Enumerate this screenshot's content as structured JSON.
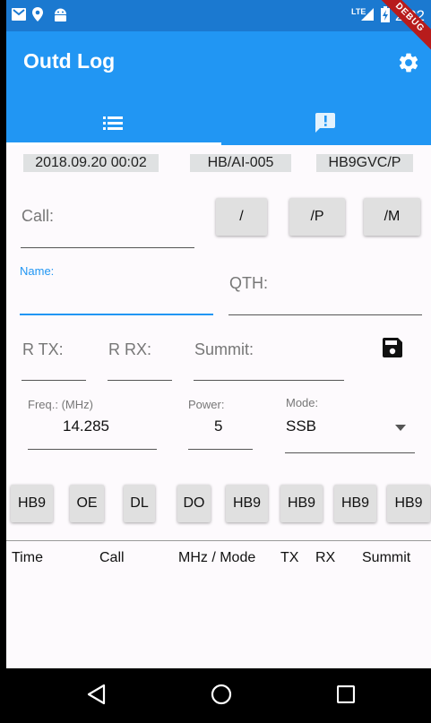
{
  "status_bar": {
    "time": "2:02",
    "network": "LTE"
  },
  "app_bar": {
    "title": "Outd Log",
    "debug_banner": "DEBUG"
  },
  "tabs": [
    {
      "name": "log-list"
    },
    {
      "name": "alerts"
    }
  ],
  "info": {
    "datetime": "2018.09.20 00:02",
    "summit_ref": "HB/AI-005",
    "callsign": "HB9GVC/P"
  },
  "form": {
    "call_label": "Call:",
    "call_value": "",
    "suffix_buttons": [
      "/",
      "/P",
      "/M"
    ],
    "name_label": "Name:",
    "name_value": "",
    "qth_label": "QTH:",
    "qth_value": "",
    "rtx_label": "R TX:",
    "rrx_label": "R RX:",
    "summit_label": "Summit:",
    "freq_label": "Freq.: (MHz)",
    "freq_value": "14.285",
    "power_label": "Power:",
    "power_value": "5",
    "mode_label": "Mode:",
    "mode_value": "SSB"
  },
  "prefix_buttons": [
    "HB9",
    "OE",
    "DL",
    "DO",
    "HB9",
    "HB9",
    "HB9",
    "HB9"
  ],
  "table_headers": [
    "Time",
    "Call",
    "MHz / Mode",
    "TX",
    "RX",
    "Summit"
  ],
  "colors": {
    "primary": "#2196f3",
    "status_bar": "#1b79d0",
    "accent": "#2196f3"
  }
}
